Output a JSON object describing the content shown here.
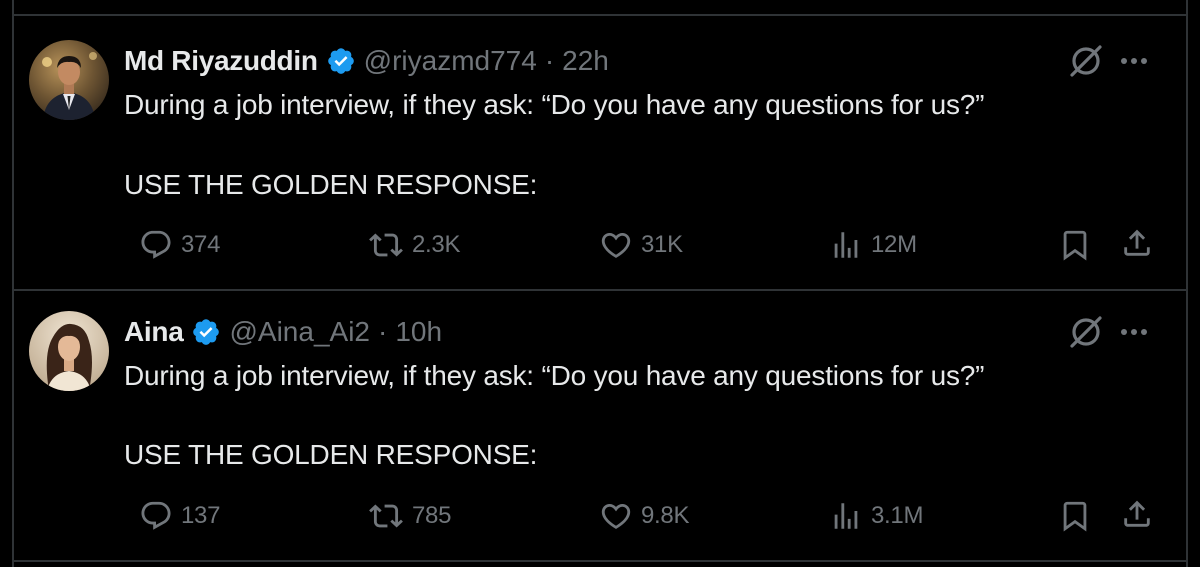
{
  "tweets": [
    {
      "author_name": "Md Riyazuddin",
      "handle": "@riyazmd774",
      "separator": "·",
      "time": "22h",
      "line1": "During a job interview, if they ask: “Do you have any questions for us?”",
      "line2": "USE THE GOLDEN RESPONSE:",
      "replies": "374",
      "reposts": "2.3K",
      "likes": "31K",
      "views": "12M"
    },
    {
      "author_name": "Aina",
      "handle": "@Aina_Ai2",
      "separator": "·",
      "time": "10h",
      "line1": "During a job interview, if they ask: “Do you have any questions for us?”",
      "line2": "USE THE GOLDEN RESPONSE:",
      "replies": "137",
      "reposts": "785",
      "likes": "9.8K",
      "views": "3.1M"
    }
  ],
  "colors": {
    "background": "#000000",
    "divider": "#2f3336",
    "text_primary": "#e7e9ea",
    "text_secondary": "#71767b",
    "verified_badge": "#1d9bf0"
  },
  "icons": [
    "verified-badge-icon",
    "grok-icon",
    "more-icon",
    "reply-icon",
    "repost-icon",
    "like-icon",
    "views-icon",
    "bookmark-icon",
    "share-icon"
  ]
}
